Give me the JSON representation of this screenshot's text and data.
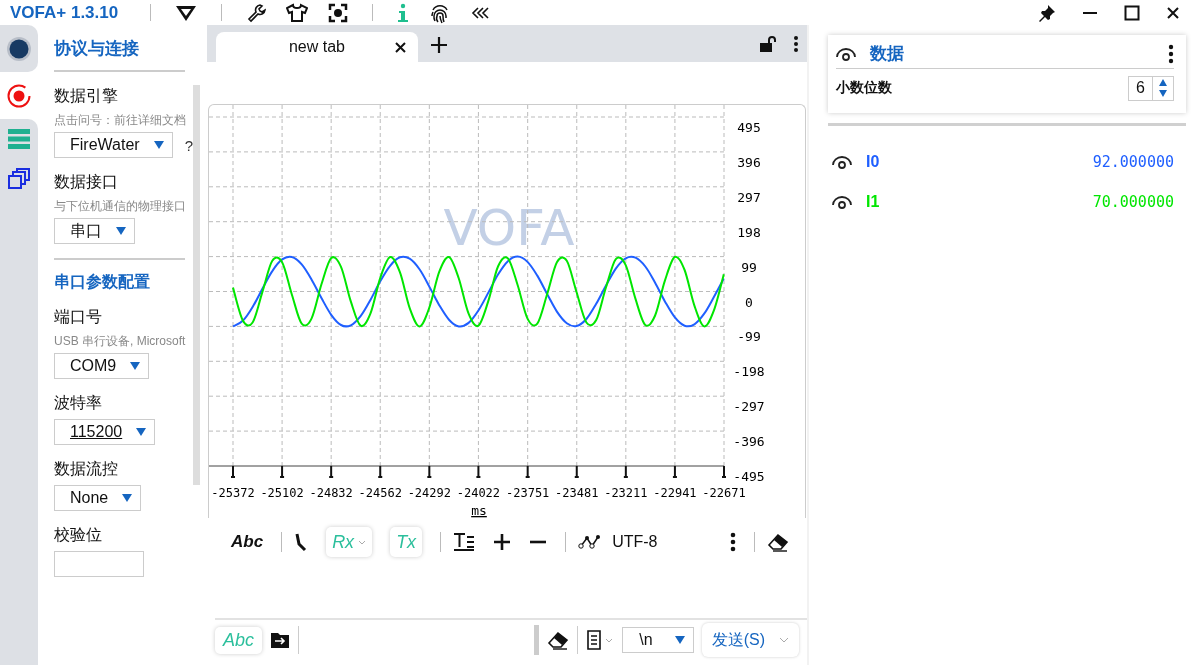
{
  "window": {
    "title": "VOFA+ 1.3.10"
  },
  "rail": {
    "items": [
      {
        "kind": "connect",
        "selected": true
      },
      {
        "kind": "record",
        "selected": false
      },
      {
        "kind": "list",
        "selected": false
      },
      {
        "kind": "windows",
        "selected": false
      }
    ]
  },
  "config": {
    "title": "协议与连接",
    "items": [
      {
        "kind": "field",
        "label": "数据引擎",
        "hint": "点击问号：前往详细文档",
        "value": "FireWater",
        "help": "?"
      },
      {
        "kind": "field",
        "label": "数据接口",
        "hint": "与下位机通信的物理接口",
        "value": "串口"
      },
      {
        "kind": "divider"
      },
      {
        "kind": "heading",
        "text": "串口参数配置"
      },
      {
        "kind": "field",
        "label": "端口号",
        "hint": "USB 串行设备, Microsoft",
        "value": "COM9"
      },
      {
        "kind": "field",
        "label": "波特率",
        "value": "115200",
        "editable": true
      },
      {
        "kind": "field",
        "label": "数据流控",
        "value": "None"
      },
      {
        "kind": "field",
        "label": "校验位"
      }
    ]
  },
  "tabs": [
    {
      "label": "new tab",
      "selected": true
    }
  ],
  "chart": {
    "background_logo": "VOFA",
    "chart_data": {
      "type": "line",
      "xlabel": "ms",
      "xlim": [
        -25372,
        -22671
      ],
      "ylim": [
        -495,
        495
      ],
      "grid": true,
      "xticks": [
        {
          "value": -25372,
          "label": "-25372"
        },
        {
          "value": -25102,
          "label": "-25102"
        },
        -24832,
        -24562,
        -24292,
        -24022,
        -23751,
        -23481,
        -23211,
        -22941,
        -22671
      ],
      "yticks": [
        495,
        396,
        297,
        198,
        99,
        0,
        -99,
        -198,
        -297,
        -396,
        -495
      ],
      "x": [
        -25372,
        -25318,
        -25264,
        -25210,
        -25156,
        -25102,
        -25048,
        -24994,
        -24940,
        -24886,
        -24832,
        -24778,
        -24724,
        -24670,
        -24616,
        -24562,
        -24508,
        -24454,
        -24400,
        -24346,
        -24292,
        -24238,
        -24184,
        -24130,
        -24076,
        -24022,
        -23968,
        -23914,
        -23860,
        -23806,
        -23752,
        -23698,
        -23644,
        -23590,
        -23536,
        -23482,
        -23428,
        -23374,
        -23320,
        -23266,
        -23212,
        -23158,
        -23104,
        -23050,
        -22996,
        -22942,
        -22888,
        -22834,
        -22780,
        -22726,
        -22672
      ],
      "series": [
        {
          "name": "I0",
          "color": "#1f5fff",
          "values": [
            -99,
            -83,
            -44,
            8,
            58,
            91,
            98,
            77,
            34,
            -18,
            -66,
            -95,
            -96,
            -70,
            -24,
            29,
            73,
            97,
            93,
            63,
            14,
            -38,
            -80,
            -99,
            -89,
            -54,
            -4,
            48,
            86,
            99,
            84,
            45,
            -7,
            -57,
            -90,
            -98,
            -78,
            -35,
            17,
            65,
            94,
            96,
            71,
            25,
            -28,
            -73,
            -97,
            -93,
            -63,
            -15,
            37
          ]
        },
        {
          "name": "I1",
          "color": "#00e600",
          "values": [
            11,
            -82,
            -88,
            -1,
            87,
            83,
            -9,
            -91,
            -77,
            19,
            95,
            70,
            -28,
            -97,
            -63,
            38,
            98,
            55,
            -47,
            -99,
            -46,
            55,
            98,
            37,
            -63,
            -97,
            -28,
            71,
            94,
            18,
            -77,
            -91,
            -8,
            83,
            87,
            -2,
            -88,
            -81,
            12,
            92,
            75,
            -21,
            -95,
            -68,
            31,
            98,
            61,
            -40,
            -99,
            -53,
            49
          ]
        }
      ]
    }
  },
  "toolbar": [
    {
      "kind": "text",
      "label": "Abc",
      "selected": false
    },
    {
      "kind": "sep"
    },
    {
      "kind": "cursor"
    },
    {
      "kind": "chip",
      "label": "Rx",
      "selected": true,
      "dropdown": true
    },
    {
      "kind": "chip",
      "label": "Tx",
      "selected": true,
      "dropdown": false
    },
    {
      "kind": "sep"
    },
    {
      "kind": "format"
    },
    {
      "kind": "plus"
    },
    {
      "kind": "minus"
    },
    {
      "kind": "sep"
    },
    {
      "kind": "encoding",
      "label": "UTF-8"
    },
    {
      "kind": "spacer"
    },
    {
      "kind": "more"
    },
    {
      "kind": "sep"
    },
    {
      "kind": "erase"
    }
  ],
  "send_bar": {
    "mode": {
      "label": "Abc",
      "selected": true
    },
    "line_ending": "\\n",
    "send": "发送(S)"
  },
  "data_panel": {
    "title": "数据",
    "decimals_label": "小数位数",
    "decimals": "6",
    "channels": [
      {
        "value": "92.000000"
      },
      {
        "value": "70.000000"
      }
    ]
  }
}
